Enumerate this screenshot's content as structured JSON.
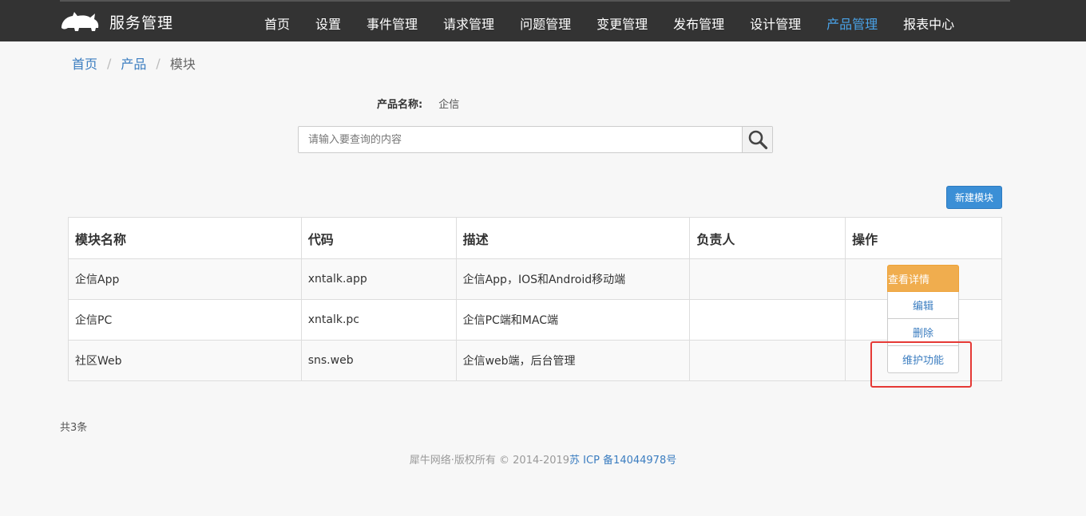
{
  "navbar": {
    "brand_text": "服务管理",
    "logo_icon": "rhino-icon",
    "items": [
      {
        "label": "首页"
      },
      {
        "label": "设置"
      },
      {
        "label": "事件管理"
      },
      {
        "label": "请求管理"
      },
      {
        "label": "问题管理"
      },
      {
        "label": "变更管理"
      },
      {
        "label": "发布管理"
      },
      {
        "label": "设计管理"
      },
      {
        "label": "产品管理",
        "active": true
      },
      {
        "label": "报表中心"
      }
    ],
    "active_color": "#4aa3e8"
  },
  "breadcrumb": {
    "items": [
      "首页",
      "产品",
      "模块"
    ],
    "separator": "/"
  },
  "product": {
    "label": "产品名称:",
    "value": "企信"
  },
  "search": {
    "placeholder": "请输入要查询的内容",
    "value": "",
    "icon": "search-icon"
  },
  "new_module_button": "新建模块",
  "table": {
    "headers": [
      "模块名称",
      "代码",
      "描述",
      "负责人",
      "操作"
    ],
    "rows": [
      {
        "name": "企信App",
        "code": "xntalk.app",
        "desc": "企信App，IOS和Android移动端",
        "owner": ""
      },
      {
        "name": "企信PC",
        "code": "xntalk.pc",
        "desc": "企信PC端和MAC端",
        "owner": ""
      },
      {
        "name": "社区Web",
        "code": "sns.web",
        "desc": "企信web端，后台管理",
        "owner": ""
      }
    ]
  },
  "ops_menu": {
    "detail": "查看详情",
    "edit": "编辑",
    "delete": "删除",
    "maintain": "维护功能"
  },
  "total_text": "共3条",
  "footer": {
    "copyright": "犀牛网络·版权所有 © 2014-2019",
    "icp": "苏 ICP 备14044978号"
  },
  "colors": {
    "navbar_bg": "#333333",
    "primary": "#3b8fd6",
    "warning": "#f0ad4e",
    "highlight": "#e53935"
  }
}
